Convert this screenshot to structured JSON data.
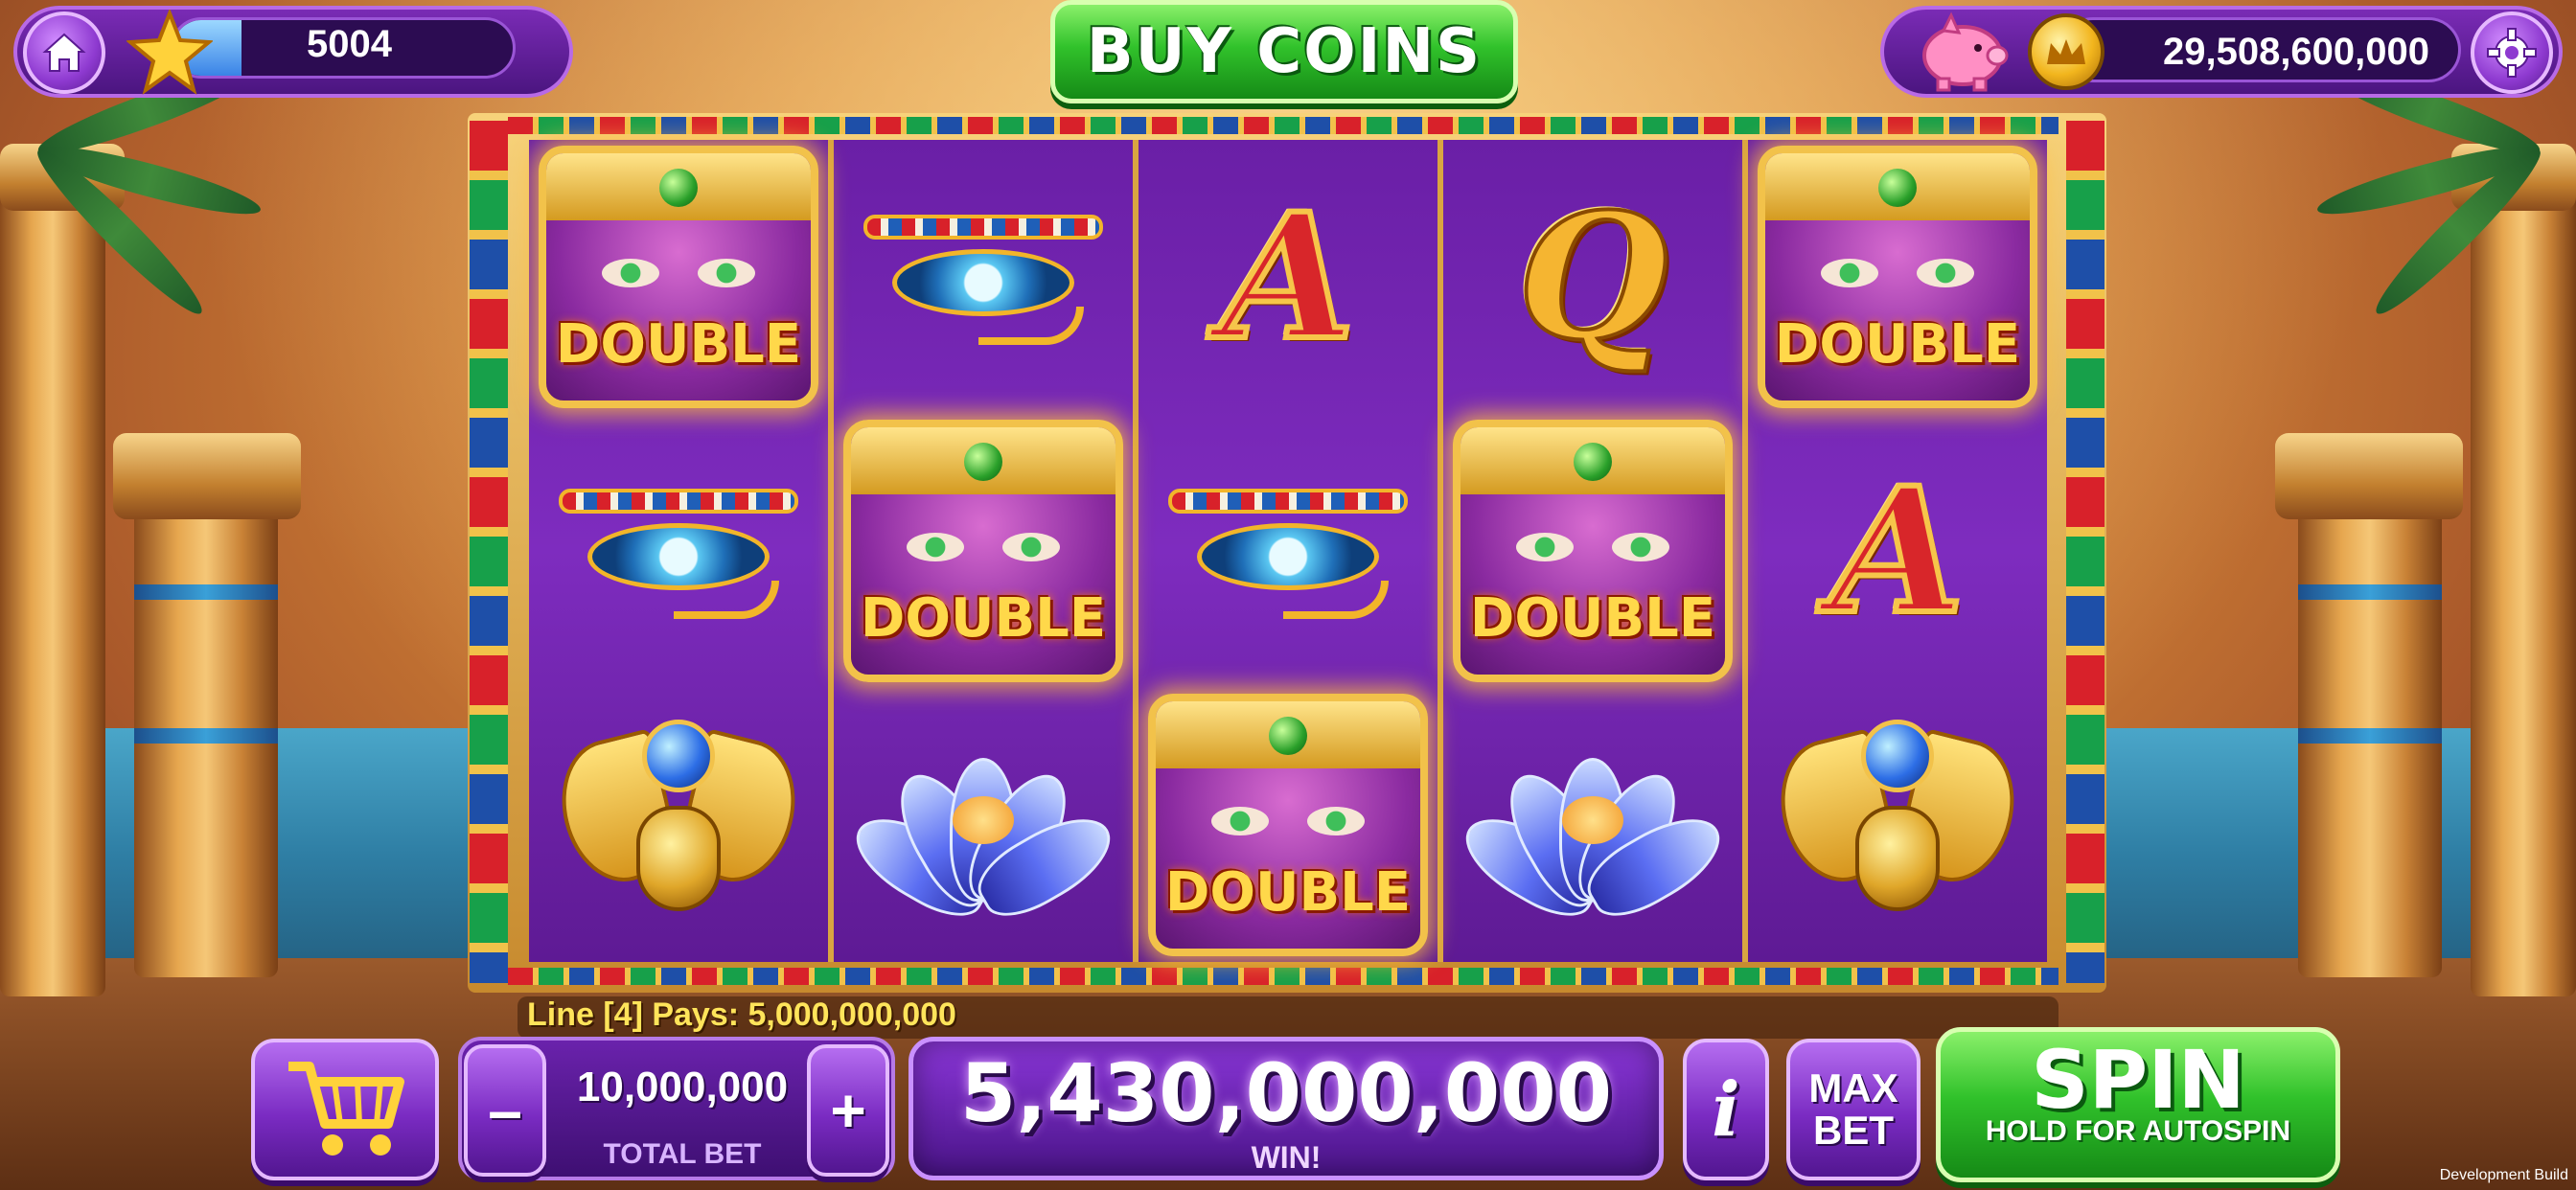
{
  "header": {
    "level": "5004",
    "level_progress_percent": 20,
    "buy_coins_label": "BUY COINS",
    "coin_balance": "29,508,600,000"
  },
  "reels": [
    [
      "double",
      "eye",
      "scarab"
    ],
    [
      "eye",
      "double",
      "lotus"
    ],
    [
      "A",
      "eye",
      "double"
    ],
    [
      "Q",
      "double",
      "lotus"
    ],
    [
      "double",
      "A",
      "scarab"
    ]
  ],
  "symbol_text": {
    "double": "DOUBLE",
    "A": "A",
    "Q": "Q"
  },
  "footer": {
    "line_pays": "Line [4] Pays: 5,000,000,000",
    "total_bet": "10,000,000",
    "total_bet_label": "TOTAL BET",
    "minus_label": "–",
    "plus_label": "+",
    "win_amount": "5,430,000,000",
    "win_label": "WIN!",
    "info_label": "i",
    "max_bet_label": "MAX\nBET",
    "spin_label": "SPIN",
    "spin_sub_label": "HOLD FOR AUTOSPIN"
  },
  "watermark": "Development Build",
  "colors": {
    "accent_purple": "#7a2bc2",
    "spin_green": "#31c22b",
    "coin_gold": "#f2b51d"
  },
  "icons": [
    "home-icon",
    "star-icon",
    "piggy-bank-icon",
    "gold-coin-icon",
    "gear-icon",
    "shopping-cart-icon"
  ]
}
